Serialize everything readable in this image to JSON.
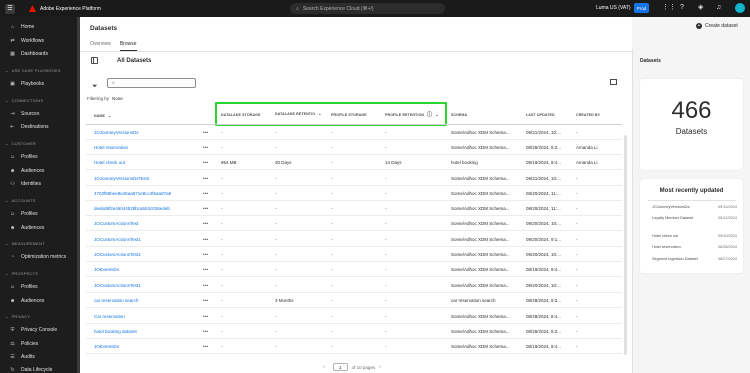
{
  "topbar": {
    "menu_icon": "hamburger-icon",
    "app_title": "Adobe Experience Platform",
    "search_placeholder": "Search Experience Cloud (⌘+/)",
    "org": "Luma US (VAT)",
    "env_badge": "Prod",
    "icons": [
      "apps-grid-icon",
      "help-icon",
      "notifications-icon",
      "bell-icon",
      "avatar"
    ]
  },
  "sidebar": {
    "top_items": [
      {
        "label": "Home",
        "icon": "home-icon"
      },
      {
        "label": "Workflows",
        "icon": "workflows-icon"
      },
      {
        "label": "Dashboards",
        "icon": "dashboards-icon"
      }
    ],
    "sections": [
      {
        "title": "USE CASE PLAYBOOKS",
        "items": [
          {
            "label": "Playbooks",
            "icon": "playbooks-icon"
          }
        ]
      },
      {
        "title": "CONNECTIONS",
        "items": [
          {
            "label": "Sources",
            "icon": "sources-icon"
          },
          {
            "label": "Destinations",
            "icon": "destinations-icon"
          }
        ]
      },
      {
        "title": "CUSTOMER",
        "items": [
          {
            "label": "Profiles",
            "icon": "profiles-icon"
          },
          {
            "label": "Audiences",
            "icon": "audiences-icon"
          },
          {
            "label": "Identities",
            "icon": "identities-icon"
          }
        ]
      },
      {
        "title": "ACCOUNTS",
        "items": [
          {
            "label": "Profiles",
            "icon": "profiles-icon"
          },
          {
            "label": "Audiences",
            "icon": "audiences-icon"
          }
        ]
      },
      {
        "title": "MEASUREMENT",
        "items": [
          {
            "label": "Optimization metrics",
            "icon": "metrics-icon"
          }
        ]
      },
      {
        "title": "PROSPECTS",
        "items": [
          {
            "label": "Profiles",
            "icon": "profiles-icon"
          },
          {
            "label": "Audiences",
            "icon": "audiences-icon"
          }
        ]
      },
      {
        "title": "PRIVACY",
        "items": [
          {
            "label": "Privacy Console",
            "icon": "privacy-icon"
          },
          {
            "label": "Policies",
            "icon": "policies-icon"
          },
          {
            "label": "Audits",
            "icon": "audits-icon"
          },
          {
            "label": "Data Lifecycle",
            "icon": "lifecycle-icon"
          }
        ]
      }
    ]
  },
  "page": {
    "title": "Datasets",
    "tabs": [
      "Overview",
      "Browse"
    ],
    "active_tab": "Browse",
    "content_title": "All Datasets",
    "create_button": "Create dataset",
    "search_value": "",
    "filtering_label": "Filtering by",
    "filtering_value": "None"
  },
  "table": {
    "headers": {
      "name": "NAME",
      "dls": "DATALAKE STORAGE",
      "dlr": "DATALAKE RETENTIO",
      "ps": "PROFILE STORAGE",
      "pr": "PROFILE RETENTION",
      "schema": "SCHEMA",
      "updated": "LAST UPDATED",
      "created": "CREATED BY"
    },
    "rows": [
      {
        "name": "JOJourneyVersionsDs",
        "dls": "-",
        "dlr": "-",
        "ps": "-",
        "pr": "-",
        "schema": "Some/Adhoc XDM Schema...",
        "updated": "09/21/2024, 10:...",
        "created": "-"
      },
      {
        "name": "Hotel reservation",
        "dls": "-",
        "dlr": "-",
        "ps": "-",
        "pr": "-",
        "schema": "Some/Adhoc XDM Schema...",
        "updated": "08/28/2024, 8:2...",
        "created": "Amanda Li"
      },
      {
        "name": "Hotel check out",
        "dls": "954 MB",
        "dlr": "30 Days",
        "ps": "-",
        "pr": "14 Days",
        "schema": "hotel booking",
        "updated": "09/19/2024, 9:4...",
        "created": "Amanda Li"
      },
      {
        "name": "JOJourneyVersionsDsTest2",
        "dls": "-",
        "dlr": "-",
        "ps": "-",
        "pr": "-",
        "schema": "Some/Adhoc XDM Schema...",
        "updated": "09/21/2024, 10:...",
        "created": "-"
      },
      {
        "name": "4703f59bee8e46aa971e8cc4f5aa87a8",
        "dls": "-",
        "dlr": "-",
        "ps": "-",
        "pr": "-",
        "schema": "Some/Adhoc XDM Schema...",
        "updated": "08/20/2024, 11:...",
        "created": "-"
      },
      {
        "name": "deabd9f2e46044b28bca553c026edeb",
        "dls": "-",
        "dlr": "-",
        "ps": "-",
        "pr": "-",
        "schema": "Some/Adhoc XDM Schema...",
        "updated": "09/20/2024, 11:...",
        "created": "-"
      },
      {
        "name": "JOCustomActionsTest",
        "dls": "-",
        "dlr": "-",
        "ps": "-",
        "pr": "-",
        "schema": "Some/Adhoc XDM Schema...",
        "updated": "09/20/2024, 10:...",
        "created": "-"
      },
      {
        "name": "JOCustomActionsTest1",
        "dls": "-",
        "dlr": "-",
        "ps": "-",
        "pr": "-",
        "schema": "Some/Adhoc XDM Schema...",
        "updated": "09/20/2024, 9:1...",
        "created": "-"
      },
      {
        "name": "JOCustomActionsTest1",
        "dls": "-",
        "dlr": "-",
        "ps": "-",
        "pr": "-",
        "schema": "Some/Adhoc XDM Schema...",
        "updated": "09/20/2024, 10:...",
        "created": "-"
      },
      {
        "name": "JOEventsDs",
        "dls": "-",
        "dlr": "-",
        "ps": "-",
        "pr": "-",
        "schema": "Some/Adhoc XDM Schema...",
        "updated": "08/19/2024, 9:4...",
        "created": "-"
      },
      {
        "name": "JOCustomActionsTest1",
        "dls": "-",
        "dlr": "-",
        "ps": "-",
        "pr": "-",
        "schema": "Some/Adhoc XDM Schema...",
        "updated": "09/20/2024, 10:...",
        "created": "-"
      },
      {
        "name": "car reservation search",
        "dls": "-",
        "dlr": "3 Months",
        "ps": "-",
        "pr": "-",
        "schema": "car reservation search",
        "updated": "08/28/2024, 9:3...",
        "created": "-"
      },
      {
        "name": "Car reservation",
        "dls": "-",
        "dlr": "-",
        "ps": "-",
        "pr": "-",
        "schema": "Some/Adhoc XDM Schema...",
        "updated": "08/28/2024, 8:4...",
        "created": "-"
      },
      {
        "name": "hotel booking dataset",
        "dls": "-",
        "dlr": "-",
        "ps": "-",
        "pr": "-",
        "schema": "Some/Adhoc XDM Schema...",
        "updated": "08/28/2024, 8:2...",
        "created": "-"
      },
      {
        "name": "JOEventsDs",
        "dls": "-",
        "dlr": "-",
        "ps": "-",
        "pr": "-",
        "schema": "Some/Adhoc XDM Schema...",
        "updated": "08/19/2024, 9:4...",
        "created": "-"
      }
    ],
    "row_action": "•••"
  },
  "pagination": {
    "current_page": "1",
    "of_pages": "of 10 pages",
    "prev": "‹",
    "next": "›"
  },
  "right_rail": {
    "title": "Datasets",
    "count": "466",
    "count_label": "Datasets",
    "recent_title": "Most recently updated",
    "recent": [
      {
        "name": "JOJourneyVersionsDs",
        "date": "09/15/2024"
      },
      {
        "name": "Loyalty Member Dataset",
        "date": "09/12/2024"
      },
      {
        "name": "Hotel check out",
        "date": "09/10/2024"
      },
      {
        "name": "Hotel reservation",
        "date": "08/28/2024"
      },
      {
        "name": "Segment Ingestion Dataset",
        "date": "08/27/2024"
      }
    ]
  },
  "highlight_color": "#2ed530",
  "accent_color": "#1473e6"
}
